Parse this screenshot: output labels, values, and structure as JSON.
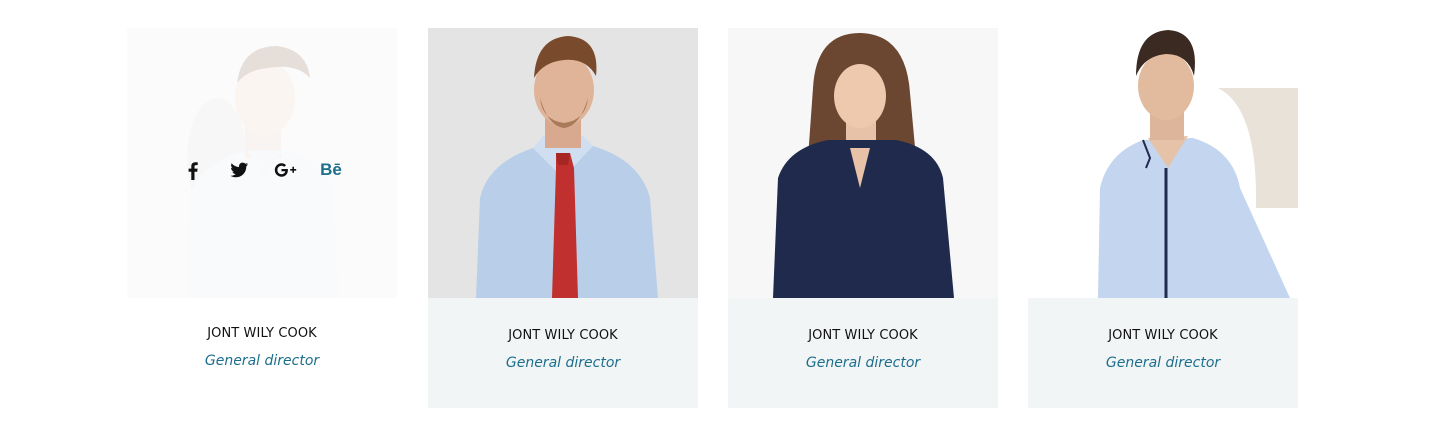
{
  "team": {
    "members": [
      {
        "name": "JONT WILY COOK",
        "role": "General director"
      },
      {
        "name": "JONT WILY COOK",
        "role": "General director"
      },
      {
        "name": "JONT WILY COOK",
        "role": "General director"
      },
      {
        "name": "JONT WILY COOK",
        "role": "General director"
      }
    ],
    "social": {
      "facebook_icon": "facebook-icon",
      "twitter_icon": "twitter-icon",
      "googleplus_icon": "google-plus-icon",
      "behance_label": "Bē"
    }
  },
  "colors": {
    "role_text": "#1c6e8c",
    "info_background": "#f2f5f6",
    "behance_accent": "#1c6e8c"
  }
}
